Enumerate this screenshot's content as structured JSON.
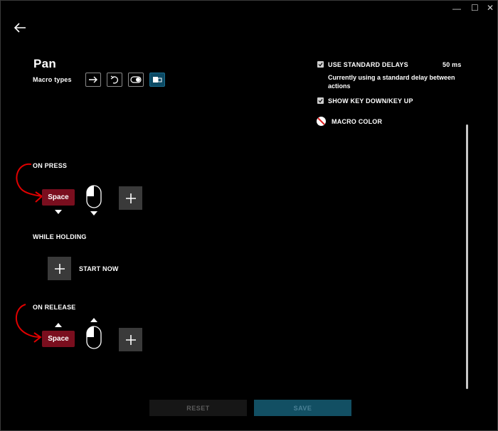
{
  "window": {
    "minimize_glyph": "—",
    "maximize_glyph": "☐",
    "close_glyph": "✕"
  },
  "header": {
    "title": "Pan",
    "macro_types_label": "Macro types"
  },
  "macro_types": [
    "arrow-right-icon",
    "repeat-icon",
    "toggle-icon",
    "sequence-icon"
  ],
  "options": {
    "use_standard_delays_label": "USE STANDARD DELAYS",
    "delay_value": "50 ms",
    "delay_description": "Currently using a standard delay between actions",
    "show_key_down_up_label": "SHOW KEY DOWN/KEY UP",
    "macro_color_label": "MACRO COLOR"
  },
  "sections": {
    "on_press": {
      "label": "ON PRESS",
      "key": "Space"
    },
    "while_holding": {
      "label": "WHILE HOLDING",
      "start_now": "START NOW"
    },
    "on_release": {
      "label": "ON RELEASE",
      "key": "Space"
    }
  },
  "footer": {
    "reset_label": "RESET",
    "save_label": "SAVE"
  },
  "colors": {
    "key_red": "#7a0e1e",
    "save_teal": "#124f63",
    "annotation_red": "#e00000"
  }
}
